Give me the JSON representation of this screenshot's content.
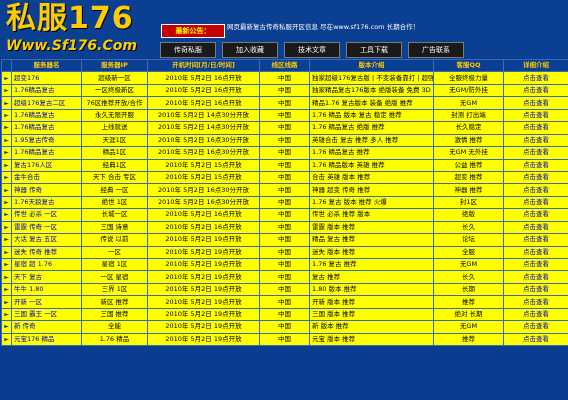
{
  "header": {
    "logo_text": "私服176",
    "logo_url": "Www.Sf176.Com",
    "notice_label": "最新公告：",
    "notice_text": "网页最新复古传奇私服开区信息 尽在www.sf176.com 长期合作！",
    "nav": [
      "传奇私服",
      "加入收藏",
      "技术文章",
      "工具下载",
      "广告联系"
    ]
  },
  "table": {
    "columns": [
      "服务器名",
      "服务器IP",
      "开机时间[月/日/时间]",
      "线区线路",
      "版本介绍",
      "客服QQ",
      "详细介绍"
    ],
    "rows": [
      {
        "name": "超变176",
        "ip": "超级新一区",
        "time": "2010年 5月2日 16点开放",
        "line": "中国",
        "intro": "独家超级176复古版 | 不变装备靠打 | 超强攻击，独一无二",
        "qq": "全服终极力量",
        "link": "点击查看"
      },
      {
        "name": "1.76精品复古",
        "ip": "一区终极新区",
        "time": "2010年 5月2日 16点开放",
        "line": "中国",
        "intro": "独家精品复古176版本 绝版装备 免费 3D 推荐",
        "qq": "无GM/防外挂",
        "link": "点击查看"
      },
      {
        "name": "超级176复古二区",
        "ip": "76区推荐开放/合作",
        "time": "2010年 5月2日 16点开放",
        "line": "中国",
        "intro": "精品1.76 复古版本 装备 绝版 推荐",
        "qq": "无GM",
        "link": "点击查看"
      },
      {
        "name": "1.76精品复古",
        "ip": "永久无限开服",
        "time": "2010年 5月2日 14点30分开放",
        "line": "中国",
        "intro": "1.76 精品 版本 复古 稳定 推荐",
        "qq": "封测 打出端",
        "link": "点击查看"
      },
      {
        "name": "1.76精品复古",
        "ip": "上线就送",
        "time": "2010年 5月2日 14点30分开放",
        "line": "中国",
        "intro": "1.76 精品复古 绝版 推荐",
        "qq": "长久稳定",
        "link": "点击查看"
      },
      {
        "name": "1.95复古传奇",
        "ip": "天涯1区",
        "time": "2010年 5月2日 16点30分开放",
        "line": "中国",
        "intro": "英雄合击 复古 推荐 多人 推荐",
        "qq": "激情 推荐",
        "link": "点击查看"
      },
      {
        "name": "1.76精品复古",
        "ip": "精品1区",
        "time": "2010年 5月2日 16点30分开放",
        "line": "中国",
        "intro": "1.76 精品复古 推荐",
        "qq": "无GM 无外挂",
        "link": "点击查看"
      },
      {
        "name": "复古176人区",
        "ip": "经典1区",
        "time": "2010年 5月2日 15点开放",
        "line": "中国",
        "intro": "1.76 精品版本 英雄 推荐",
        "qq": "公益 推荐",
        "link": "点击查看"
      },
      {
        "name": "金牛合击",
        "ip": "天下 合击 专区",
        "time": "2010年 5月2日 15点开放",
        "line": "中国",
        "intro": "合击 英雄 版本 推荐",
        "qq": "超变 推荐",
        "link": "点击查看"
      },
      {
        "name": "神器 传奇",
        "ip": "经典 一区",
        "time": "2010年 5月2日 16点30分开放",
        "line": "中国",
        "intro": "神器 超变 传奇 推荐",
        "qq": "神器 推荐",
        "link": "点击查看"
      },
      {
        "name": "1.76天狼复古",
        "ip": "绝世 1区",
        "time": "2010年 5月2日 16点30分开放",
        "line": "中国",
        "intro": "1.76 复古 版本 推荐 火爆",
        "qq": "封1区",
        "link": "点击查看"
      },
      {
        "name": "传世 必杀 一区",
        "ip": "长城一区",
        "time": "2010年 5月2日 16点开放",
        "line": "中国",
        "intro": "传世 必杀 推荐 版本",
        "qq": "绝版",
        "link": "点击查看"
      },
      {
        "name": "雷霆 传奇 一区",
        "ip": "三国 诗意",
        "time": "2010年 5月2日 16点开放",
        "line": "中国",
        "intro": "雷霆 版本 推荐",
        "qq": "长久",
        "link": "点击查看"
      },
      {
        "name": "大话 复古 五区",
        "ip": "传说 以前",
        "time": "2010年 5月2日 19点开放",
        "line": "中国",
        "intro": "精品 复古 推荐",
        "qq": "论坛",
        "link": "点击查看"
      },
      {
        "name": "迷失 传奇 推荐",
        "ip": "一区",
        "time": "2010年 5月2日 19点开放",
        "line": "中国",
        "intro": "迷失 版本 推荐",
        "qq": "全服",
        "link": "点击查看"
      },
      {
        "name": "星宿 超 1.76",
        "ip": "星宿 1区",
        "time": "2010年 5月2日 19点开放",
        "line": "中国",
        "intro": "1.76 复古 推荐",
        "qq": "无GM",
        "link": "点击查看"
      },
      {
        "name": "天下 复古",
        "ip": "一区 星宿",
        "time": "2010年 5月2日 19点开放",
        "line": "中国",
        "intro": "复古 推荐",
        "qq": "长久",
        "link": "点击查看"
      },
      {
        "name": "牛牛 1.80",
        "ip": "三界 1区",
        "time": "2010年 5月2日 19点开放",
        "line": "中国",
        "intro": "1.80 版本 推荐",
        "qq": "长期",
        "link": "点击查看"
      },
      {
        "name": "开新 一区",
        "ip": "新区 推荐",
        "time": "2010年 5月2日 19点开放",
        "line": "中国",
        "intro": "开新 版本 推荐",
        "qq": "推荐",
        "link": "点击查看"
      },
      {
        "name": "三国 霸王 一区",
        "ip": "三国 推荐",
        "time": "2010年 5月2日 19点开放",
        "line": "中国",
        "intro": "三国 版本 推荐",
        "qq": "绝对 长期",
        "link": "点击查看"
      },
      {
        "name": "新 传奇",
        "ip": "全能",
        "time": "2010年 5月2日 19点开放",
        "line": "中国",
        "intro": "新 版本 推荐",
        "qq": "无GM",
        "link": "点击查看"
      },
      {
        "name": "元宝176 精品",
        "ip": "1.76 精品",
        "time": "2010年 5月2日 19点开放",
        "line": "中国",
        "intro": "元宝 版本 推荐",
        "qq": "推荐",
        "link": "点击查看"
      }
    ]
  }
}
